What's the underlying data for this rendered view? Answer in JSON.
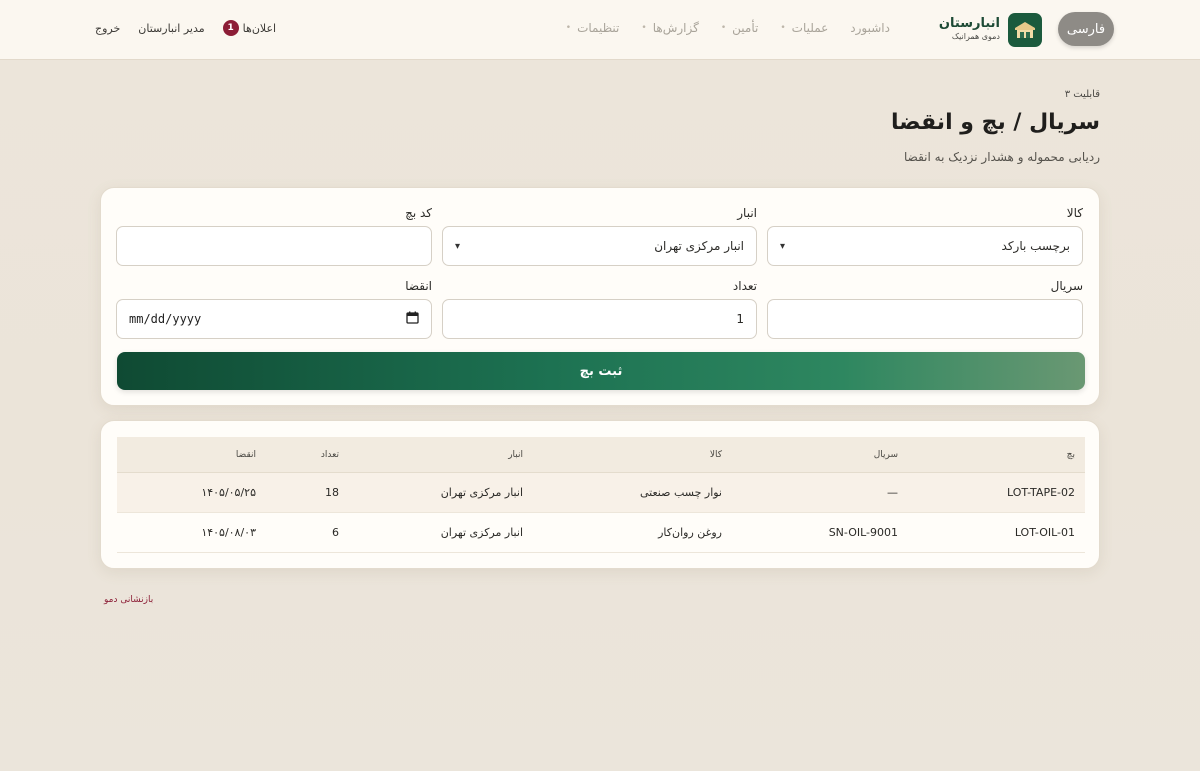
{
  "header": {
    "language_button": "فارسی",
    "brand_name": "انبارستان",
    "brand_subtitle": "دموی همرانیک",
    "nav": [
      {
        "label": "داشبورد",
        "dot": false
      },
      {
        "label": "عملیات",
        "dot": true
      },
      {
        "label": "تأمین",
        "dot": true
      },
      {
        "label": "گزارش‌ها",
        "dot": true
      },
      {
        "label": "تنظیمات",
        "dot": true
      }
    ],
    "notifications_label": "اعلان‌ها",
    "notifications_count": "1",
    "user_label": "مدیر انبارستان",
    "logout_label": "خروج"
  },
  "page": {
    "kicker": "قابلیت ۳",
    "title": "سریال / بچ و انقضا",
    "subtitle": "ردیابی محموله و هشدار نزدیک به انقضا"
  },
  "form": {
    "item_label": "کالا",
    "item_value": "برچسب بارکد",
    "warehouse_label": "انبار",
    "warehouse_value": "انبار مرکزی تهران",
    "batch_code_label": "کد بچ",
    "batch_code_value": "",
    "serial_label": "سریال",
    "serial_value": "",
    "quantity_label": "تعداد",
    "quantity_value": "1",
    "expiry_label": "انقضا",
    "expiry_placeholder": "mm/dd/yyyy",
    "submit_label": "ثبت بچ"
  },
  "table": {
    "columns": {
      "batch": "بچ",
      "serial": "سریال",
      "item": "کالا",
      "warehouse": "انبار",
      "quantity": "تعداد",
      "expiry": "انقضا"
    },
    "rows": [
      {
        "batch": "LOT-TAPE-02",
        "serial": "—",
        "item": "نوار چسب صنعتی",
        "warehouse": "انبار مرکزی تهران",
        "quantity": "18",
        "expiry": "۱۴۰۵/۰۵/۲۵"
      },
      {
        "batch": "LOT-OIL-01",
        "serial": "SN-OIL-9001",
        "item": "روغن روان‌کار",
        "warehouse": "انبار مرکزی تهران",
        "quantity": "6",
        "expiry": "۱۴۰۵/۰۸/۰۳"
      }
    ]
  },
  "footer": {
    "reset_demo": "بازنشانی دمو"
  },
  "colors": {
    "brand_green": "#1b5a3d",
    "accent_red": "#8c1d36"
  }
}
